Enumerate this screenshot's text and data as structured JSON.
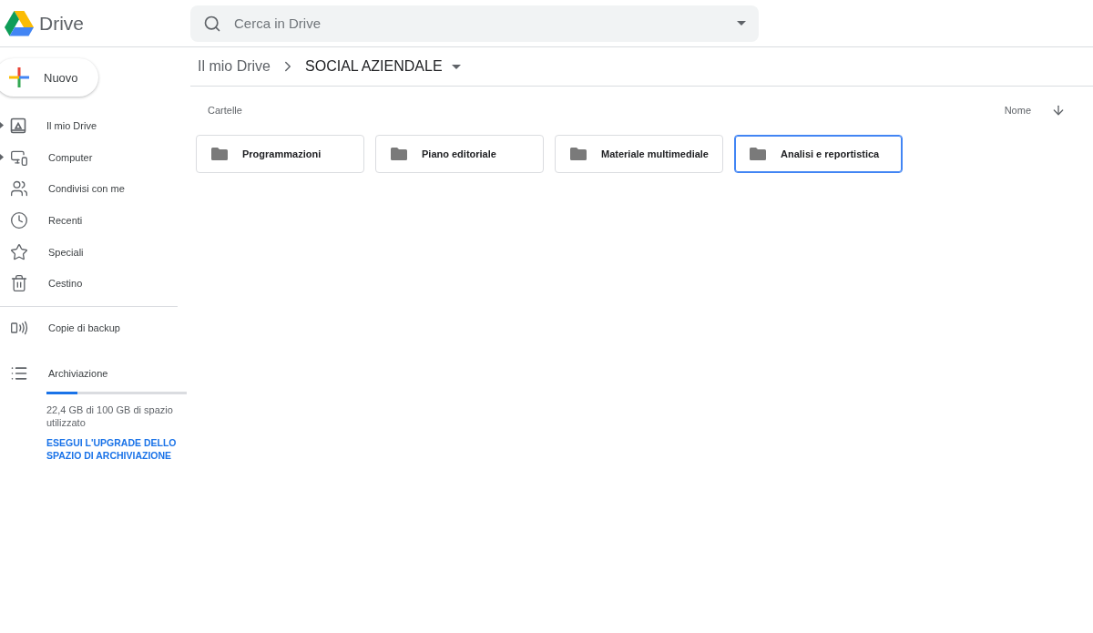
{
  "app": {
    "name": "Drive"
  },
  "search": {
    "placeholder": "Cerca in Drive"
  },
  "new_button": {
    "label": "Nuovo"
  },
  "sidebar": {
    "items": [
      {
        "label": "Il mio Drive",
        "expandable": true
      },
      {
        "label": "Computer",
        "expandable": true
      },
      {
        "label": "Condivisi con me",
        "expandable": false
      },
      {
        "label": "Recenti",
        "expandable": false
      },
      {
        "label": "Speciali",
        "expandable": false
      },
      {
        "label": "Cestino",
        "expandable": false
      }
    ],
    "backup": {
      "label": "Copie di backup"
    },
    "storage": {
      "label": "Archiviazione",
      "level": 0.224,
      "usage": "22,4 GB di 100 GB di spazio utilizzato",
      "upgrade_link": "ESEGUI L'UPGRADE DELLO SPAZIO DI ARCHIVIAZIONE"
    }
  },
  "breadcrumb": [
    "Il mio Drive",
    "SOCIAL AZIENDALE"
  ],
  "section_title": "Cartelle",
  "sort": {
    "label": "Nome"
  },
  "folders": [
    {
      "name": "Programmazioni",
      "selected": false
    },
    {
      "name": "Piano editoriale",
      "selected": false
    },
    {
      "name": "Materiale multimediale",
      "selected": false
    },
    {
      "name": "Analisi e reportistica",
      "selected": true
    }
  ]
}
